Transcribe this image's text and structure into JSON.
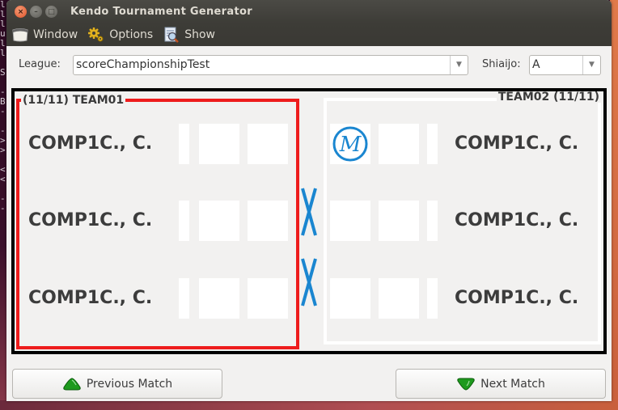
{
  "window": {
    "title": "Kendo Tournament Generator",
    "controls": [
      "close",
      "minimize",
      "maximize"
    ]
  },
  "menubar": {
    "items": [
      {
        "label": "Window",
        "icon": "window-icon"
      },
      {
        "label": "Options",
        "icon": "gears-icon"
      },
      {
        "label": "Show",
        "icon": "magnifier-document-icon"
      }
    ]
  },
  "filters": {
    "league_label": "League:",
    "league_value": "scoreChampionshipTest",
    "shiaijo_label": "Shiaijo:",
    "shiaijo_value": "A"
  },
  "match": {
    "team_left": {
      "label": "(11/11) TEAM01",
      "highlight_color": "#ee1c1c",
      "competitors": [
        {
          "name": "COMP1C., C.",
          "scores": [
            "",
            "",
            ""
          ]
        },
        {
          "name": "COMP1C., C.",
          "scores": [
            "",
            "",
            ""
          ]
        },
        {
          "name": "COMP1C., C.",
          "scores": [
            "",
            "",
            ""
          ]
        }
      ]
    },
    "team_right": {
      "label": "TEAM02 (11/11)",
      "competitors": [
        {
          "name": "COMP1C., C.",
          "scores": [
            "M",
            "",
            ""
          ]
        },
        {
          "name": "COMP1C., C.",
          "scores": [
            "",
            "",
            ""
          ]
        },
        {
          "name": "COMP1C., C.",
          "scores": [
            "",
            "",
            ""
          ]
        }
      ]
    },
    "faults_between_rows": [
      "X",
      "X"
    ],
    "accent_color": "#1a86d0"
  },
  "buttons": {
    "previous": "Previous Match",
    "next": "Next Match"
  },
  "background_terminal": {
    "chars": [
      "l",
      "l",
      "l",
      "u",
      "l",
      "l",
      "",
      "S",
      "",
      "-",
      "B",
      "-",
      "",
      "-",
      ">",
      ">",
      "",
      "<",
      "<",
      "",
      "-",
      "-"
    ]
  }
}
